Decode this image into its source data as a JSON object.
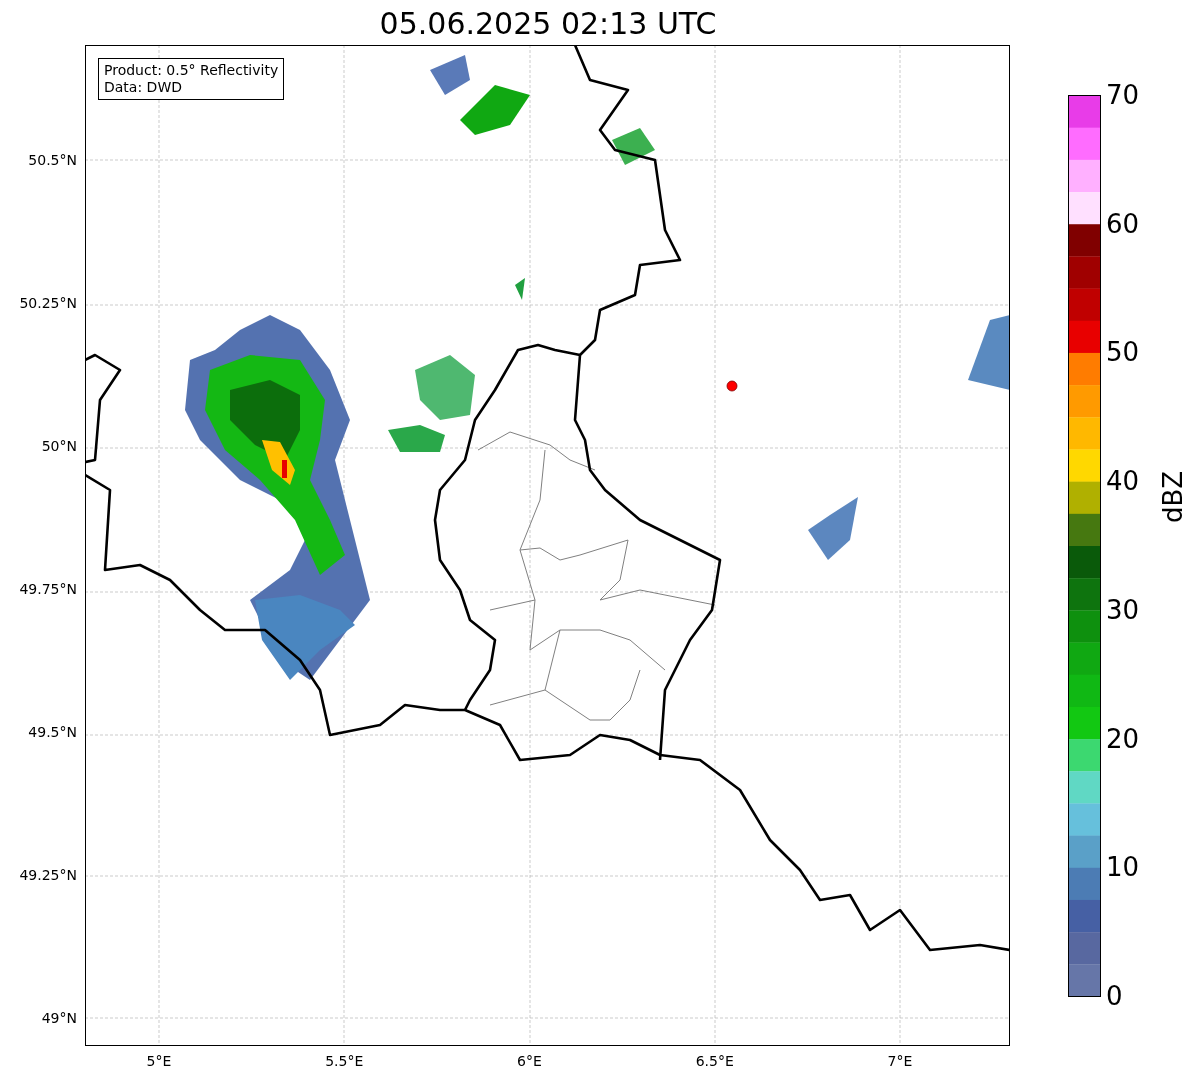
{
  "title": "05.06.2025 02:13 UTC",
  "legend": {
    "lines": [
      "Product: 0.5° Reflectivity",
      "Data: DWD"
    ]
  },
  "x_axis": {
    "ticks": [
      "5°E",
      "5.5°E",
      "6°E",
      "6.5°E",
      "7°E"
    ]
  },
  "y_axis": {
    "ticks": [
      "50.5°N",
      "50.25°N",
      "50°N",
      "49.75°N",
      "49.5°N",
      "49.25°N",
      "49°N"
    ]
  },
  "colorbar": {
    "label": "dBZ",
    "ticks": [
      "70",
      "60",
      "50",
      "40",
      "30",
      "20",
      "10",
      "0"
    ]
  }
}
